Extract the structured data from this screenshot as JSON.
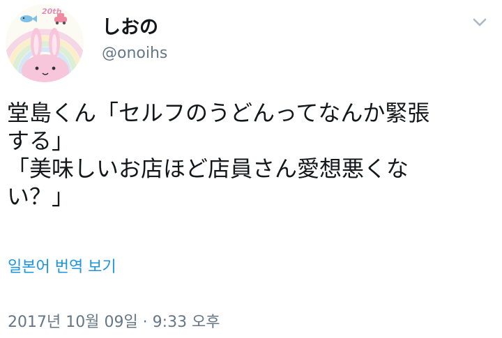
{
  "user": {
    "display_name": "しおの",
    "handle": "@onoihs",
    "avatar_badge": "20th"
  },
  "tweet": {
    "lines": [
      "堂島くん「セルフのうどんってなんか緊張",
      "する」",
      "「美味しいお店ほど店員さん愛想悪くな",
      "い？」"
    ]
  },
  "translate_link": "일본어 번역 보기",
  "timestamp": "2017년 10월 09일 · 9:33 오후",
  "colors": {
    "text": "#14171a",
    "secondary": "#657786",
    "link": "#1b95e0"
  },
  "icons": {
    "menu_caret": "chevron-down-icon"
  }
}
